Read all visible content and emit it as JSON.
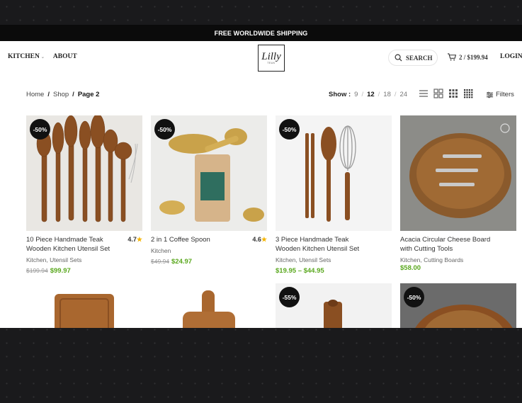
{
  "topbar": {
    "text": "FREE WORLDWIDE SHIPPING"
  },
  "header": {
    "nav": [
      {
        "label": "KITCHEN"
      },
      {
        "label": "ABOUT"
      }
    ],
    "logo_text": "Lilly",
    "logo_sub": "TEAK",
    "search_label": "SEARCH",
    "cart_label": "2 / $199.94",
    "login_label": "LOGIN"
  },
  "breadcrumb": {
    "home": "Home",
    "shop": "Shop",
    "current": "Page 2",
    "sep": "/"
  },
  "show": {
    "label": "Show :",
    "options": [
      "9",
      "12",
      "18",
      "24"
    ],
    "active": "12"
  },
  "filters_label": "Filters",
  "products": [
    {
      "name": "10 Piece Handmade Teak Wooden Kitchen Utensil Set",
      "rating": "4.7",
      "categories": "Kitchen, Utensil Sets",
      "old_price": "$199.94",
      "price": "$99.97",
      "badge": "-50%"
    },
    {
      "name": "2 in 1 Coffee Spoon",
      "rating": "4.6",
      "categories": "Kitchen",
      "old_price": "$49.94",
      "price": "$24.97",
      "badge": "-50%"
    },
    {
      "name": "3 Piece Handmade Teak Wooden Kitchen Utensil Set",
      "rating": "",
      "categories": "Kitchen, Utensil Sets",
      "old_price": "",
      "price": "$19.95 – $44.95",
      "badge": "-50%"
    },
    {
      "name": "Acacia Circular Cheese Board with Cutting Tools",
      "rating": "",
      "categories": "Kitchen, Cutting Boards",
      "old_price": "",
      "price": "$58.00",
      "badge": ""
    },
    {
      "name": "",
      "badge": ""
    },
    {
      "name": "",
      "badge": ""
    },
    {
      "name": "",
      "badge": "-55%"
    },
    {
      "name": "",
      "badge": "-50%"
    }
  ],
  "colors": {
    "accent_price": "#5aa81e",
    "star": "#f5b400",
    "badge_bg": "#111111"
  }
}
